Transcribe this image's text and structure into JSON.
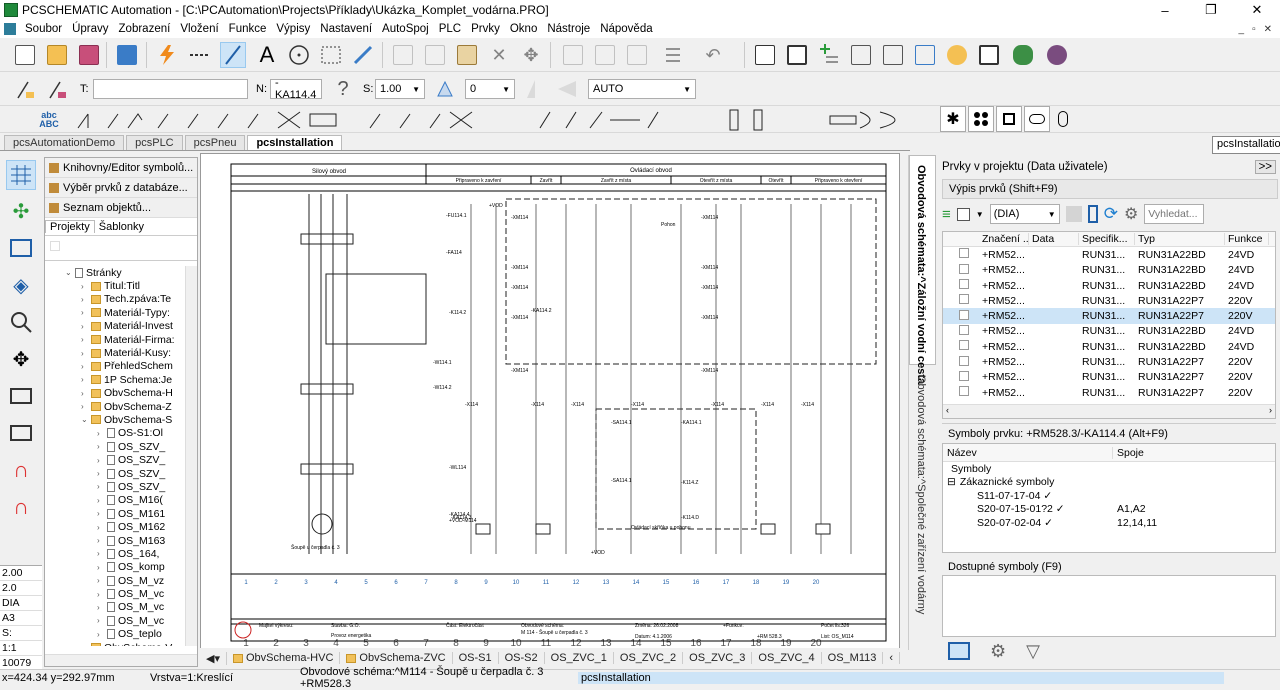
{
  "window": {
    "title": "PCSCHEMATIC Automation - [C:\\PCAutomation\\Projects\\Příklady\\Ukázka_Komplet_vodárna.PRO]",
    "min": "–",
    "max": "❐",
    "close": "✕"
  },
  "menu": [
    "Soubor",
    "Úpravy",
    "Zobrazení",
    "Vložení",
    "Funkce",
    "Výpisy",
    "Nastavení",
    "AutoSpoj",
    "PLC",
    "Prvky",
    "Okno",
    "Nástroje",
    "Nápověda"
  ],
  "mdi_controls": {
    "min": "_",
    "restore": "▫",
    "close": "✕"
  },
  "toolbar2": {
    "t_label": "T:",
    "t_value": "",
    "n_label": "N:",
    "n_value": "-KA114.4",
    "s_label": "S:",
    "s_value": "1.00",
    "angle_value": "0",
    "auto_value": "AUTO"
  },
  "toolbar3": {
    "abc_label": "abc\nABC"
  },
  "doc_tabs": [
    "pcsAutomationDemo",
    "pcsPLC",
    "pcsPneu",
    "pcsInstallation"
  ],
  "doc_tab_active": "pcsInstallation",
  "tooltip": "pcsInstallation",
  "left_values": [
    "2.00",
    "2.0",
    "DIA",
    "A3",
    "S:",
    "1:1",
    "10079"
  ],
  "left_panel": {
    "buttons": [
      "Knihovny/Editor symbolů...",
      "Výběr prvků z databáze...",
      "Seznam objektů..."
    ],
    "tabs": [
      "Projekty",
      "Šablonky"
    ],
    "tree": [
      {
        "t": "Stránky",
        "lvl": 0,
        "kind": "page",
        "arrow": "⌄"
      },
      {
        "t": "Titul:Titl",
        "lvl": 1,
        "kind": "folder",
        "arrow": "›"
      },
      {
        "t": "Tech.zpáva:Te",
        "lvl": 1,
        "kind": "folder",
        "arrow": "›"
      },
      {
        "t": "Materiál-Typy:",
        "lvl": 1,
        "kind": "folder",
        "arrow": "›"
      },
      {
        "t": "Materiál-Invest",
        "lvl": 1,
        "kind": "folder",
        "arrow": "›"
      },
      {
        "t": "Materiál-Firma:",
        "lvl": 1,
        "kind": "folder",
        "arrow": "›"
      },
      {
        "t": "Materiál-Kusy:",
        "lvl": 1,
        "kind": "folder",
        "arrow": "›"
      },
      {
        "t": "PřehledSchem",
        "lvl": 1,
        "kind": "folder",
        "arrow": "›"
      },
      {
        "t": "1P Schema:Je",
        "lvl": 1,
        "kind": "folder",
        "arrow": "›"
      },
      {
        "t": "ObvSchema-H",
        "lvl": 1,
        "kind": "folder",
        "arrow": "›"
      },
      {
        "t": "ObvSchema-Z",
        "lvl": 1,
        "kind": "folder",
        "arrow": "›"
      },
      {
        "t": "ObvSchema-S",
        "lvl": 1,
        "kind": "folder",
        "arrow": "⌄"
      },
      {
        "t": "OS-S1:Ol",
        "lvl": 2,
        "kind": "page",
        "arrow": "›"
      },
      {
        "t": "OS_SZV_",
        "lvl": 2,
        "kind": "page",
        "arrow": "›"
      },
      {
        "t": "OS_SZV_",
        "lvl": 2,
        "kind": "page",
        "arrow": "›"
      },
      {
        "t": "OS_SZV_",
        "lvl": 2,
        "kind": "page",
        "arrow": "›"
      },
      {
        "t": "OS_SZV_",
        "lvl": 2,
        "kind": "page",
        "arrow": "›"
      },
      {
        "t": "OS_M16(",
        "lvl": 2,
        "kind": "page",
        "arrow": "›"
      },
      {
        "t": "OS_M161",
        "lvl": 2,
        "kind": "page",
        "arrow": "›"
      },
      {
        "t": "OS_M162",
        "lvl": 2,
        "kind": "page",
        "arrow": "›"
      },
      {
        "t": "OS_M163",
        "lvl": 2,
        "kind": "page",
        "arrow": "›"
      },
      {
        "t": "OS_164,",
        "lvl": 2,
        "kind": "page",
        "arrow": "›"
      },
      {
        "t": "OS_komp",
        "lvl": 2,
        "kind": "page",
        "arrow": "›"
      },
      {
        "t": "OS_M_vz",
        "lvl": 2,
        "kind": "page",
        "arrow": "›"
      },
      {
        "t": "OS_M_vc",
        "lvl": 2,
        "kind": "page",
        "arrow": "›"
      },
      {
        "t": "OS_M_vc",
        "lvl": 2,
        "kind": "page",
        "arrow": "›"
      },
      {
        "t": "OS_M_vc",
        "lvl": 2,
        "kind": "page",
        "arrow": "›"
      },
      {
        "t": "OS_teplo",
        "lvl": 2,
        "kind": "page",
        "arrow": "›"
      },
      {
        "t": "ObvSchema-V",
        "lvl": 1,
        "kind": "folder",
        "arrow": "›"
      }
    ]
  },
  "drawing": {
    "header_left": "Silový obvod",
    "header_right": "Ovládací obvod",
    "subheaders": [
      "Připraveno k zavření",
      "Zavřít",
      "Zavřít z místa",
      "Otevřít z místa",
      "Otevřít",
      "Připraveno k otevření"
    ],
    "labels": [
      "-FU114.1",
      "-FA114",
      "-K114.2",
      "-KA114.2",
      "-W114.1",
      "-W114.2",
      "-KA114.1",
      "-WL114",
      "+VOD-M114",
      "-KA114.3",
      "-KA114.4",
      "-K114.D",
      "-K114.Z",
      "-SA114.1",
      "-SA114.1",
      "-XM114",
      "-XM114",
      "-XM114",
      "-XM114",
      "-XM114",
      "-XM114",
      "-XM114",
      "-XM114",
      "-XM114",
      "-XM114",
      "-X114",
      "-X114",
      "-X114",
      "-X114",
      "-X114",
      "-X114",
      "-X114",
      "+VOD",
      "+VOD",
      "Pohon",
      "Ovládací skříňka u pohonu",
      "Šoupě u čerpadla č. 3"
    ],
    "column_numbers": [
      "1",
      "2",
      "3",
      "4",
      "5",
      "6",
      "7",
      "8",
      "9",
      "10",
      "11",
      "12",
      "13",
      "14",
      "15",
      "16",
      "17",
      "18",
      "19",
      "20"
    ],
    "title_block": {
      "c1": "Majitel výkresu:",
      "c2": "Stavba: G.O.",
      "c3": "Provoz energetika",
      "c4": "Část: Elektročást",
      "c5": "Obvodové schéma:",
      "c6": "M 114 - Šoupě u čerpadla č. 3",
      "c7": "Změna: 26.02.2008",
      "c8": "Datum: 4.1.2006",
      "c9": "+Funkce:",
      "c10": "+RM 528.3",
      "c11": "Počet lis.:",
      "c12": "326",
      "c13": "List: OS_M114"
    }
  },
  "sheet_tabs": [
    "ObvSchema-HVC",
    "ObvSchema-ZVC",
    "OS-S1",
    "OS-S2",
    "OS_ZVC_1",
    "OS_ZVC_2",
    "OS_ZVC_3",
    "OS_ZVC_4",
    "OS_M113"
  ],
  "sheet_tabs_folders": [
    true,
    true,
    false,
    false,
    false,
    false,
    false,
    false,
    false
  ],
  "side_vertical": [
    "Obvodová schémata:^Záložní vodní cesta",
    "Obvodová schémata:^Společné zařízení vodárny"
  ],
  "right_panel": {
    "title": "Prvky v projektu (Data uživatele)",
    "expand": ">>",
    "list_title": "Výpis prvků (Shift+F9)",
    "filter_value": "(DIA)",
    "search_placeholder": "Vyhledat...",
    "columns": [
      "Značení ...",
      "Data",
      "Specifik...",
      "Typ",
      "Funkce"
    ],
    "rows": [
      [
        "+RM52...",
        "",
        "RUN31...",
        "RUN31A22BD",
        "24VD"
      ],
      [
        "+RM52...",
        "",
        "RUN31...",
        "RUN31A22BD",
        "24VD"
      ],
      [
        "+RM52...",
        "",
        "RUN31...",
        "RUN31A22BD",
        "24VD"
      ],
      [
        "+RM52...",
        "",
        "RUN31...",
        "RUN31A22P7",
        "220V"
      ],
      [
        "+RM52...",
        "",
        "RUN31...",
        "RUN31A22P7",
        "220V"
      ],
      [
        "+RM52...",
        "",
        "RUN31...",
        "RUN31A22BD",
        "24VD"
      ],
      [
        "+RM52...",
        "",
        "RUN31...",
        "RUN31A22BD",
        "24VD"
      ],
      [
        "+RM52...",
        "",
        "RUN31...",
        "RUN31A22P7",
        "220V"
      ],
      [
        "+RM52...",
        "",
        "RUN31...",
        "RUN31A22P7",
        "220V"
      ],
      [
        "+RM52...",
        "",
        "RUN31...",
        "RUN31A22P7",
        "220V"
      ]
    ],
    "selected_row": 4,
    "symbols_title": "Symboly prvku: +RM528.3/-KA114.4 (Alt+F9)",
    "sym_columns": [
      "Název",
      "Spoje"
    ],
    "sym_rows": [
      {
        "name": "Symboly",
        "spoje": "",
        "lvl": 0,
        "exp": ""
      },
      {
        "name": "Zákaznické symboly",
        "spoje": "",
        "lvl": 0,
        "exp": "⊟"
      },
      {
        "name": "S11-07-17-04 ✓",
        "spoje": "",
        "lvl": 1,
        "exp": ""
      },
      {
        "name": "S20-07-15-01?2 ✓",
        "spoje": "A1,A2",
        "lvl": 1,
        "exp": ""
      },
      {
        "name": "S20-07-02-04 ✓",
        "spoje": "12,14,11",
        "lvl": 1,
        "exp": ""
      }
    ],
    "available_title": "Dostupné symboly (F9)"
  },
  "status": {
    "coords": "x=424.34 y=292.97mm",
    "layer": "Vrstva=1:Kreslící",
    "page": "Obvodové schéma:^M114 - Šoupě u čerpadla č. 3 +RM528.3",
    "project": "pcsInstallation"
  }
}
